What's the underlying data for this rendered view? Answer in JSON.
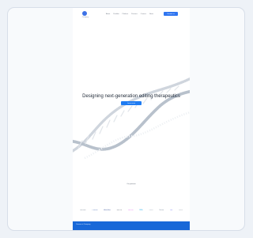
{
  "brand": {
    "name": "Company"
  },
  "nav": {
    "links": [
      "About",
      "Portfolio",
      "Platform",
      "Partners",
      "Careers",
      "News"
    ],
    "cta": "Contact us"
  },
  "hero": {
    "title": "Designing next-generation editing therapeutics",
    "button": "Learn more"
  },
  "partners": {
    "label": "Our partners",
    "items": [
      "Genome",
      "Pharma",
      "AstraGen",
      "BioLab",
      "Cell Co",
      "RNA",
      "Thera",
      "Vector",
      "Life",
      "Gene"
    ]
  },
  "footer": {
    "label": "Careers at Company"
  },
  "colors": {
    "accent": "#2f75f0",
    "dna_gray": "#cfd5dd",
    "footer": "#1868d8"
  },
  "icons": {
    "brand": "company-logo-icon"
  }
}
